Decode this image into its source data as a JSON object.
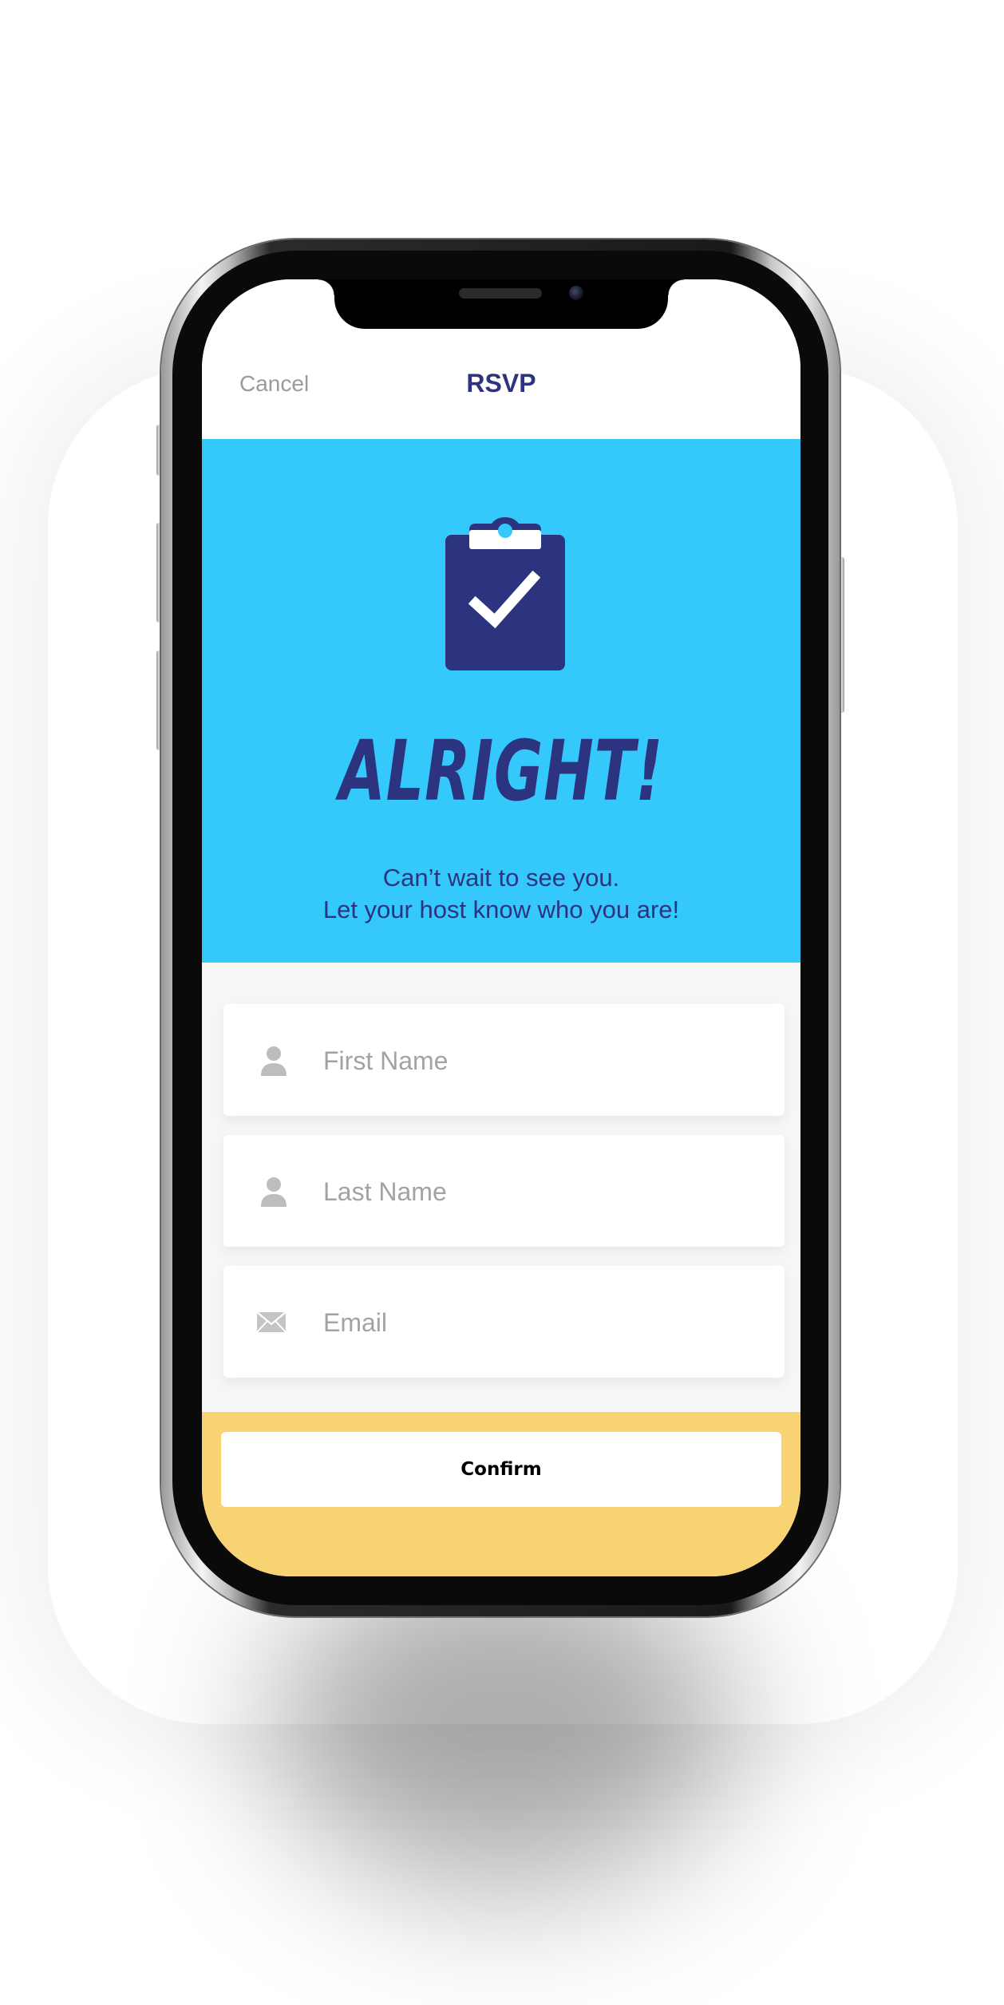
{
  "nav": {
    "cancel_label": "Cancel",
    "title": "RSVP"
  },
  "hero": {
    "icon": "clipboard-check-icon",
    "title": "ALRIGHT!",
    "subtitle_line1": "Can’t wait to see you.",
    "subtitle_line2": "Let your host know who you are!"
  },
  "form": {
    "first_name": {
      "icon": "person-icon",
      "placeholder": "First Name",
      "value": ""
    },
    "last_name": {
      "icon": "person-icon",
      "placeholder": "Last Name",
      "value": ""
    },
    "email": {
      "icon": "envelope-icon",
      "placeholder": "Email",
      "value": ""
    }
  },
  "footer": {
    "confirm_label": "Confirm"
  },
  "colors": {
    "hero_bg": "#35c8fb",
    "navy": "#2c3480",
    "footer_bg": "#f8d374",
    "placeholder": "#a3a3a3"
  }
}
